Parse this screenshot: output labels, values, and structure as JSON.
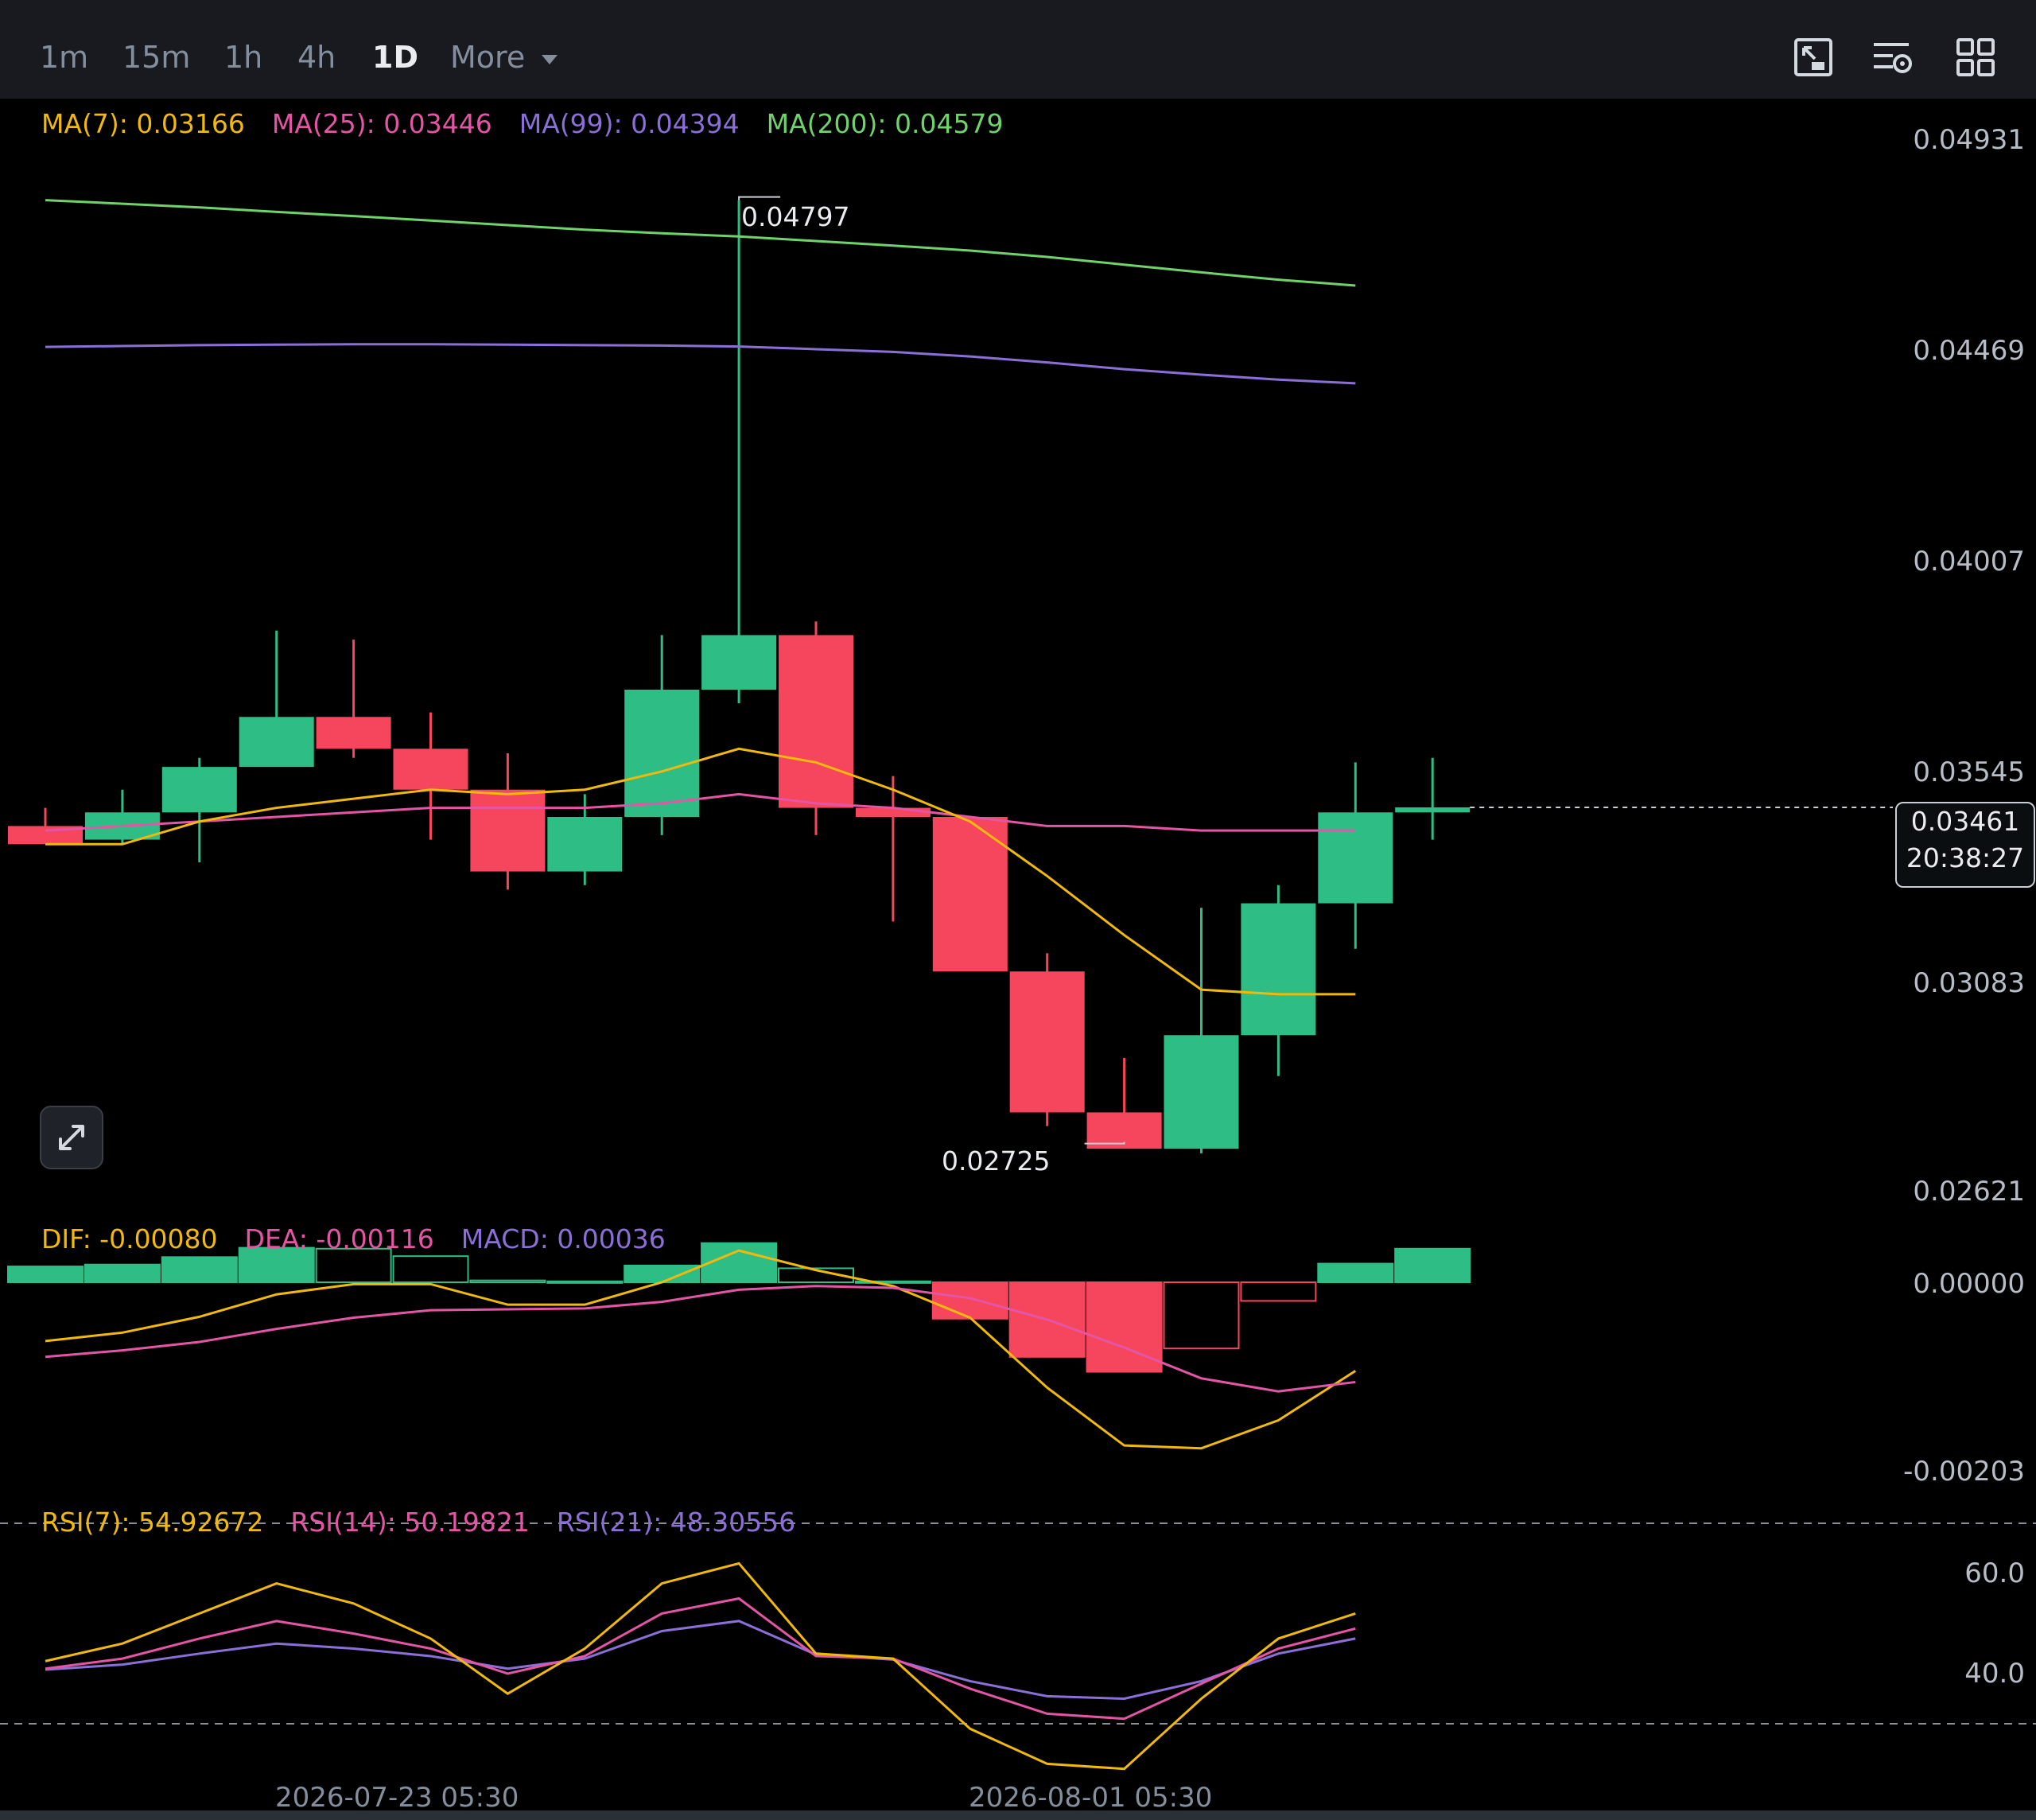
{
  "toolbar": {
    "timeframes": [
      "1m",
      "15m",
      "1h",
      "4h",
      "1D"
    ],
    "active": "1D",
    "more_label": "More",
    "icons": [
      "chart-type-icon",
      "indicator-settings-icon",
      "layout-grid-icon"
    ]
  },
  "legends": {
    "ma": [
      {
        "label": "MA(7): 0.03166",
        "color": "#f0b90b"
      },
      {
        "label": "MA(25): 0.03446",
        "color": "#e455a5"
      },
      {
        "label": "MA(99): 0.04394",
        "color": "#8b6fd6"
      },
      {
        "label": "MA(200): 0.04579",
        "color": "#6fd26b"
      }
    ],
    "macd": [
      {
        "label": "DIF: -0.00080",
        "color": "#f0b90b"
      },
      {
        "label": "DEA: -0.00116",
        "color": "#e455a5"
      },
      {
        "label": "MACD: 0.00036",
        "color": "#8b6fd6"
      }
    ],
    "rsi": [
      {
        "label": "RSI(7): 54.92672",
        "color": "#f0b90b"
      },
      {
        "label": "RSI(14): 50.19821",
        "color": "#e455a5"
      },
      {
        "label": "RSI(21): 48.30556",
        "color": "#8b6fd6"
      }
    ]
  },
  "price_axis": [
    "0.04931",
    "0.04469",
    "0.04007",
    "0.03545",
    "0.03083",
    "0.02621"
  ],
  "macd_axis": [
    "0.00000",
    "-0.00203"
  ],
  "rsi_axis": [
    "60.0",
    "40.0"
  ],
  "dates": [
    "2026-07-23 05:30",
    "2026-08-01 05:30"
  ],
  "annotations": {
    "high": "0.04797",
    "low": "0.02725"
  },
  "current_price": {
    "price": "0.03461",
    "countdown": "20:38:27"
  },
  "colors": {
    "up": "#2ebd85",
    "down": "#f6465d",
    "ma7": "#f0b90b",
    "ma25": "#e455a5",
    "ma99": "#8b6fd6",
    "ma200": "#6fd26b"
  },
  "chart_data": {
    "type": "candlestick",
    "candles": [
      {
        "o": 0.0342,
        "h": 0.0346,
        "l": 0.0339,
        "c": 0.0338
      },
      {
        "o": 0.0339,
        "h": 0.035,
        "l": 0.0338,
        "c": 0.0345
      },
      {
        "o": 0.0345,
        "h": 0.0357,
        "l": 0.0334,
        "c": 0.0355
      },
      {
        "o": 0.0355,
        "h": 0.0385,
        "l": 0.0356,
        "c": 0.0366
      },
      {
        "o": 0.0366,
        "h": 0.0383,
        "l": 0.0357,
        "c": 0.0359
      },
      {
        "o": 0.0359,
        "h": 0.0367,
        "l": 0.0339,
        "c": 0.035
      },
      {
        "o": 0.035,
        "h": 0.0358,
        "l": 0.0328,
        "c": 0.0332
      },
      {
        "o": 0.0332,
        "h": 0.0349,
        "l": 0.0329,
        "c": 0.0344
      },
      {
        "o": 0.0344,
        "h": 0.0384,
        "l": 0.034,
        "c": 0.0372
      },
      {
        "o": 0.0372,
        "h": 0.04797,
        "l": 0.0369,
        "c": 0.0384
      },
      {
        "o": 0.0384,
        "h": 0.0387,
        "l": 0.034,
        "c": 0.0346
      },
      {
        "o": 0.0346,
        "h": 0.0353,
        "l": 0.0321,
        "c": 0.0344
      },
      {
        "o": 0.0344,
        "h": 0.0344,
        "l": 0.0312,
        "c": 0.031
      },
      {
        "o": 0.031,
        "h": 0.0314,
        "l": 0.0276,
        "c": 0.0279
      },
      {
        "o": 0.0279,
        "h": 0.0291,
        "l": 0.02725,
        "c": 0.0271
      },
      {
        "o": 0.0271,
        "h": 0.0324,
        "l": 0.027,
        "c": 0.0296
      },
      {
        "o": 0.0296,
        "h": 0.0329,
        "l": 0.0287,
        "c": 0.0325
      },
      {
        "o": 0.0325,
        "h": 0.0356,
        "l": 0.0315,
        "c": 0.0345
      },
      {
        "o": 0.0345,
        "h": 0.0357,
        "l": 0.0339,
        "c": 0.03461
      }
    ],
    "ma7": [
      0.0338,
      0.0338,
      0.0343,
      0.0346,
      0.0348,
      0.035,
      0.0349,
      0.035,
      0.0354,
      0.0359,
      0.0356,
      0.035,
      0.0343,
      0.0331,
      0.0318,
      0.0306,
      0.0305,
      0.0305
    ],
    "ma25": [
      0.0341,
      0.0342,
      0.0343,
      0.0344,
      0.0345,
      0.0346,
      0.0346,
      0.0346,
      0.0347,
      0.0349,
      0.0347,
      0.0346,
      0.0344,
      0.0342,
      0.0342,
      0.0341,
      0.0341,
      0.0341
    ],
    "ma99": [
      0.04474,
      0.04476,
      0.04478,
      0.04479,
      0.0448,
      0.0448,
      0.04479,
      0.04478,
      0.04477,
      0.04475,
      0.04469,
      0.04463,
      0.04453,
      0.0444,
      0.04425,
      0.04413,
      0.04402,
      0.04394
    ],
    "ma200": [
      0.04797,
      0.04789,
      0.04781,
      0.04771,
      0.04762,
      0.04752,
      0.04742,
      0.04732,
      0.04724,
      0.04717,
      0.04707,
      0.04697,
      0.04686,
      0.04672,
      0.04655,
      0.04638,
      0.04622,
      0.04609
    ],
    "dif": [
      -0.00063,
      -0.00054,
      -0.00037,
      -0.00013,
      -2e-05,
      -2e-05,
      -0.00024,
      -0.00024,
      0.0,
      0.00034,
      0.00013,
      -4e-05,
      -0.00038,
      -0.00113,
      -0.00175,
      -0.00178,
      -0.00148,
      -0.00095,
      -0.0008
    ],
    "dea": [
      -0.0008,
      -0.00073,
      -0.00064,
      -0.0005,
      -0.00038,
      -0.0003,
      -0.00029,
      -0.00028,
      -0.00021,
      -8e-05,
      -4e-05,
      -6e-05,
      -0.00017,
      -0.0004,
      -0.0007,
      -0.00103,
      -0.00117,
      -0.00107,
      -0.00116
    ],
    "macd_hist": [
      0.00017,
      0.00019,
      0.00027,
      0.00037,
      0.00036,
      0.00028,
      2e-05,
      1e-05,
      0.00018,
      0.00042,
      0.00015,
      1e-05,
      -0.00039,
      -0.0008,
      -0.00096,
      -0.00071,
      -0.0002,
      0.0002,
      0.00036
    ],
    "rsi7": [
      42.5,
      46,
      52,
      58,
      54,
      47,
      36,
      45,
      58,
      62,
      44,
      43,
      29,
      22,
      21,
      35,
      47,
      52,
      54.93
    ],
    "rsi14": [
      41,
      43,
      47,
      50.5,
      48,
      45,
      40,
      43.5,
      52,
      55,
      43.5,
      43,
      37,
      32,
      31,
      38,
      45,
      49,
      50.2
    ],
    "rsi21": [
      40.8,
      41.8,
      44,
      46,
      45,
      43.5,
      41,
      43,
      48.5,
      50.5,
      43.8,
      42.8,
      38.5,
      35.5,
      35,
      38.5,
      44,
      47,
      48.31
    ],
    "price_axis_range": [
      0.0248,
      0.0505
    ],
    "rsi_levels": [
      70,
      30
    ]
  }
}
